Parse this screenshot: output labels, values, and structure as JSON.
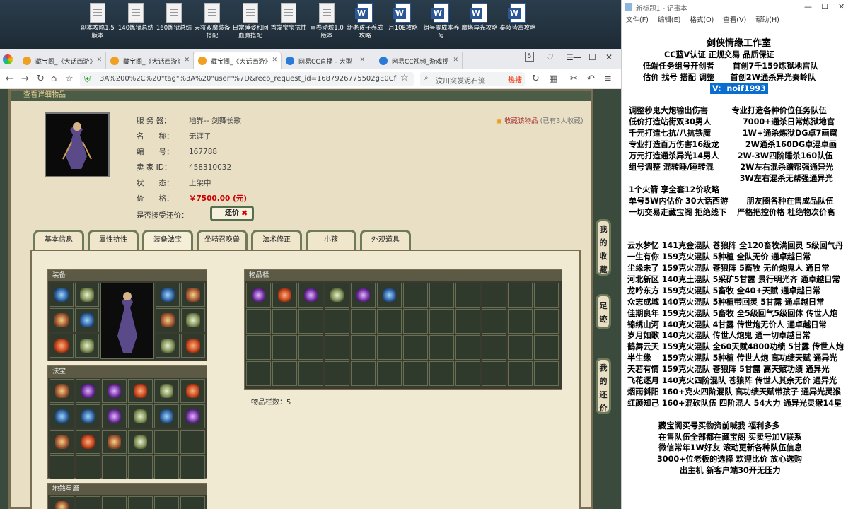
{
  "desktop": {
    "icons": [
      {
        "label": "副本攻略1.5版本",
        "type": "doc"
      },
      {
        "label": "140炼狱总结",
        "type": "doc"
      },
      {
        "label": "160炼狱总结",
        "type": "doc"
      },
      {
        "label": "天将双魔装备搭配",
        "type": "doc"
      },
      {
        "label": "日常睡姿和回血魔搭配",
        "type": "doc"
      },
      {
        "label": "首发宝宝抗性",
        "type": "doc"
      },
      {
        "label": "画卷动域1.0版本",
        "type": "doc"
      },
      {
        "label": "新老孩子养成攻略",
        "type": "word"
      },
      {
        "label": "月10E攻略",
        "type": "word"
      },
      {
        "label": "组号零成本养号",
        "type": "word"
      },
      {
        "label": "魔塔异光攻略",
        "type": "word"
      },
      {
        "label": "秦陵皆富攻略",
        "type": "word"
      }
    ]
  },
  "browser": {
    "tabs": [
      {
        "label": "藏宝阁_《大话西游》"
      },
      {
        "label": "藏宝阁_《大话西游》"
      },
      {
        "label": "藏宝阁_《大话西游》"
      },
      {
        "label": "网易CC直播 - 大型"
      },
      {
        "label": "网易CC视频_游戏视"
      }
    ],
    "tab_counter": "5",
    "url": "3A%200%2C%20\"tag\"%3A%20\"user\"%7D&reco_request_id=1687926775502gE0Cf",
    "search_text": "汶川突发泥石流",
    "search_hot": "热搜"
  },
  "game": {
    "header": "查看详细物品",
    "fields": [
      {
        "key": "服 务 器：",
        "value": "地界-- 剑舞长歌"
      },
      {
        "key": "名　　称：",
        "value": "无涯子"
      },
      {
        "key": "编　　号：",
        "value": "167788"
      },
      {
        "key": "卖 家 ID：",
        "value": "458310032"
      },
      {
        "key": "状　　态：",
        "value": "上架中"
      },
      {
        "key": "价　　格：",
        "value": "￥7500.00 (元)"
      }
    ],
    "counter_label": "是否接受还价：",
    "counter_button": "还价",
    "favorite": "收藏该物品",
    "favorite_count": "(已有3人收藏)",
    "tabs": [
      "基本信息",
      "属性抗性",
      "装备法宝",
      "坐骑召唤兽",
      "法术修正",
      "小孩",
      "外观道具"
    ],
    "active_tab": "装备法宝",
    "sections": {
      "equip": "装备",
      "treasure": "法宝",
      "bag": "物品栏",
      "stars": "地煞星層"
    },
    "bag_count": "物品栏数：5",
    "side_buttons": [
      "我的收藏",
      "足迹",
      "我的还价"
    ]
  },
  "notepad": {
    "title": "新标题1 - 记事本",
    "menu": [
      "文件(F)",
      "编辑(E)",
      "格式(O)",
      "查看(V)",
      "帮助(H)"
    ],
    "lines": [
      "剑侠情缘工作室",
      "CC蓝V认证 正规交易 品质保证",
      "低端任务组号开创者　　 首创7千159炼狱地宫队",
      "估价 找号 搭配 调整　　首创2W通杀异光秦岭队",
      "V:  noif1993",
      "",
      "调整秒鬼大炮输出伤害　　　专业打造各种价位任务队伍",
      "低价打造站街双30男人　　　　7000+通杀日常炼狱地宫",
      "千元打造七抗/八抗铁魔　　　　1W+通杀炼狱DG卓7画窟",
      "专业打造百万伤害16级龙　　　 2W通杀160DG卓混卓画",
      "万元打造通杀异光14男人　　 2W-3W四阶睡杀160队伍",
      "组号调整 混转睡/睡转混　　　 2W左右混杀蹭帮强通异光",
      "　　　　　　　　　　　　　　3W左右混杀无帮强通异光",
      "1个火箭 享全套12价攻略",
      "单号5W内估价 30大话西游　　 朋友圈各种在售成品队伍",
      "一切交易走藏宝阁 拒绝线下　 严格把控价格 杜绝物次价高",
      "",
      "",
      "云水梦忆 141克金混队 苍狼阵 全120畜牧满回灵 5级回气丹",
      "一生有你 159克火混队 5种植 全队无价 通卓越日常",
      "尘缘未了 159克火混队 苍狼阵 5畜牧 无价炮鬼人 通日常",
      "河北新区 140克土混队 5采矿5甘露 景行明光齐 通卓越日常",
      "龙吟东方 159克火混队 5畜牧 全40+天赋 通卓越日常",
      "众志成城 140克火混队 5种植带回灵 5甘露 通卓越日常",
      "佳期良年 159克火混队 5畜牧 全5级回气5级回体 传世人炮",
      "锦绣山河 140克火混队 4甘露 传世炮无价人 通卓越日常",
      "岁月如歌 140克火混队 传世人炮鬼 通一切卓越日常",
      "鹤舞云天 159克火混队 全60天赋4800功绩 5甘露 传世人炮",
      "半生缘　 159克火混队 5种植 传世人炮 高功绩天赋 通异光",
      "天若有情 159克火混队 苍狼阵 5甘露 高天赋功绩 通异光",
      "飞花逐月 140克火四阶混队 苍狼阵 传世人其余无价 通异光",
      "烟雨斜阳 160+克火四阶混队 高功绩天赋带孩子 通异光灵猴",
      "红颜知己 160+混砍队伍 四阶混人 54大力 通异光灵猴14星",
      "",
      "藏宝阁买号买物资前喊我 福利多多",
      "在售队伍全部都在藏宝阁 买卖号加V联系",
      "微信常年1W好友 滚动更新各种队伍信息",
      "3000+位老板的选择 欢迎比价 放心选购",
      "出主机 新客户端30开无压力"
    ]
  }
}
